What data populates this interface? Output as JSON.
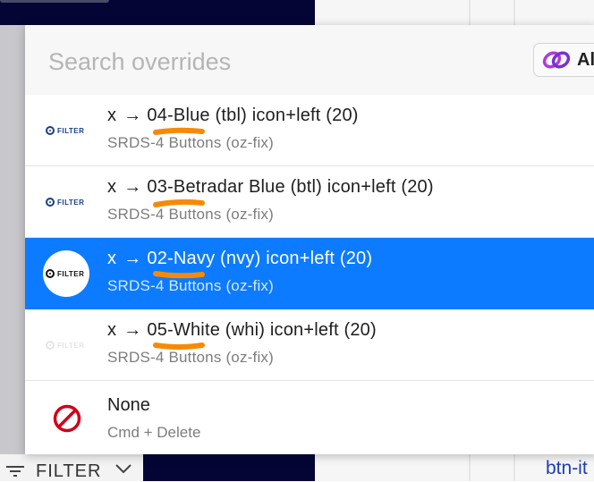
{
  "search": {
    "placeholder": "Search overrides"
  },
  "toolbar": {
    "all_label": "Al"
  },
  "overrides": [
    {
      "prefix": "x",
      "arrow": "→",
      "title": "04-Blue (tbl) icon+left (20)",
      "subtitle": "SRDS-4 Buttons (oz-fix)",
      "thumb_label": "FILTER",
      "selected": false
    },
    {
      "prefix": "x",
      "arrow": "→",
      "title": "03-Betradar Blue (btl) icon+left (20)",
      "subtitle": "SRDS-4 Buttons (oz-fix)",
      "thumb_label": "FILTER",
      "selected": false
    },
    {
      "prefix": "x",
      "arrow": "→",
      "title": "02-Navy (nvy) icon+left (20)",
      "subtitle": "SRDS-4 Buttons (oz-fix)",
      "thumb_label": "FILTER",
      "selected": true
    },
    {
      "prefix": "x",
      "arrow": "→",
      "title": "05-White (whi) icon+left (20)",
      "subtitle": "SRDS-4 Buttons (oz-fix)",
      "thumb_label": "FILTER",
      "selected": false
    }
  ],
  "none_option": {
    "title": "None",
    "subtitle": "Cmd + Delete"
  },
  "bottom_bar": {
    "label": "FILTER"
  },
  "background": {
    "link_text": "btn-it"
  },
  "colors": {
    "selection": "#0d7bff",
    "annotation": "#f58a07",
    "navy": "#050535",
    "none_icon": "#d0021b"
  }
}
